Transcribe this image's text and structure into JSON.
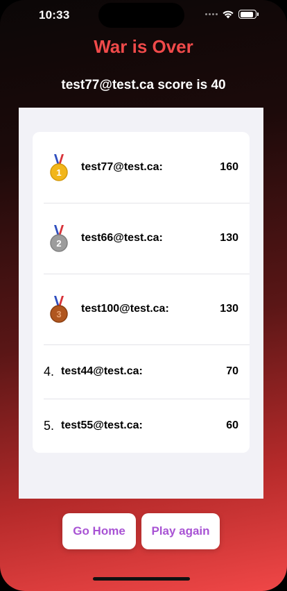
{
  "status_bar": {
    "time": "10:33",
    "battery_level": 0.9
  },
  "header": {
    "title": "War is Over",
    "score_text": "test77@test.ca score is 40"
  },
  "leaderboard": {
    "rows": [
      {
        "medal": "gold-medal-icon",
        "rank": "1",
        "name": "test77@test.ca:",
        "score": "160"
      },
      {
        "medal": "silver-medal-icon",
        "rank": "2",
        "name": "test66@test.ca:",
        "score": "130"
      },
      {
        "medal": "bronze-medal-icon",
        "rank": "3",
        "name": "test100@test.ca:",
        "score": "130"
      },
      {
        "rank_label": "4.",
        "name": "test44@test.ca:",
        "score": "70"
      },
      {
        "rank_label": "5.",
        "name": "test55@test.ca:",
        "score": "60"
      }
    ]
  },
  "buttons": {
    "home_label": "Go Home",
    "play_again_label": "Play again"
  },
  "colors": {
    "title": "#f04a4a",
    "button_text": "#a853d4",
    "gold": "#f2b61a",
    "silver": "#9c9c9c",
    "bronze": "#b0561f",
    "ribbon_blue": "#2f4fbf",
    "ribbon_red": "#d8343a"
  }
}
